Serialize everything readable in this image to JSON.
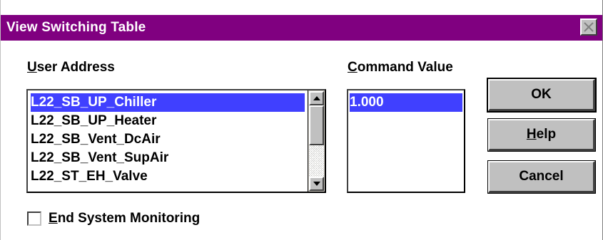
{
  "window": {
    "title": "View Switching Table",
    "close_icon": "close-x-icon"
  },
  "user_address": {
    "label_hotkey": "U",
    "label_rest": "ser Address",
    "items": [
      {
        "label": "L22_SB_UP_Chiller",
        "selected": true
      },
      {
        "label": "L22_SB_UP_Heater",
        "selected": false
      },
      {
        "label": "L22_SB_Vent_DcAir",
        "selected": false
      },
      {
        "label": "L22_SB_Vent_SupAir",
        "selected": false
      },
      {
        "label": "L22_ST_EH_Valve",
        "selected": false
      }
    ]
  },
  "command_value": {
    "label_hotkey": "C",
    "label_rest": "ommand Value",
    "items": [
      {
        "label": "1.000",
        "selected": true
      }
    ]
  },
  "buttons": {
    "ok": "OK",
    "help_hotkey": "H",
    "help_rest": "elp",
    "cancel": "Cancel"
  },
  "end_monitoring": {
    "label_hotkey": "E",
    "label_rest": "nd System Monitoring",
    "checked": false
  },
  "colors": {
    "titlebar": "#800080",
    "selection": "#4040ff",
    "button_face": "#c0c0c0"
  }
}
